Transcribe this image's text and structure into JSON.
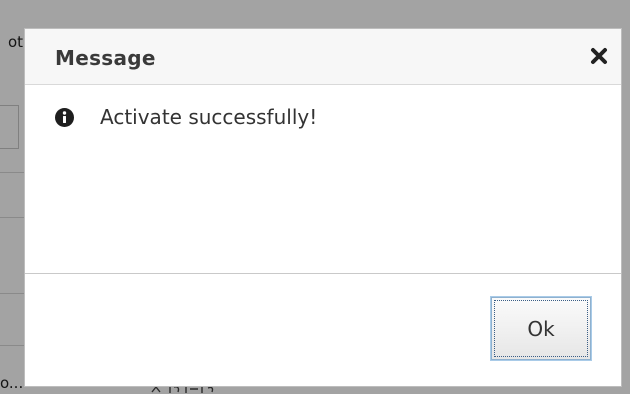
{
  "background": {
    "text_top": "ot",
    "text_bottom": "o..."
  },
  "dialog": {
    "title": "Message",
    "close_icon": "close-icon",
    "message": "Activate successfully!",
    "message_icon": "info-icon",
    "ok_label": "Ok"
  },
  "colors": {
    "overlay": "#5c5c5c",
    "header_bg": "#f7f7f7",
    "button_border": "#8fb1cf"
  }
}
